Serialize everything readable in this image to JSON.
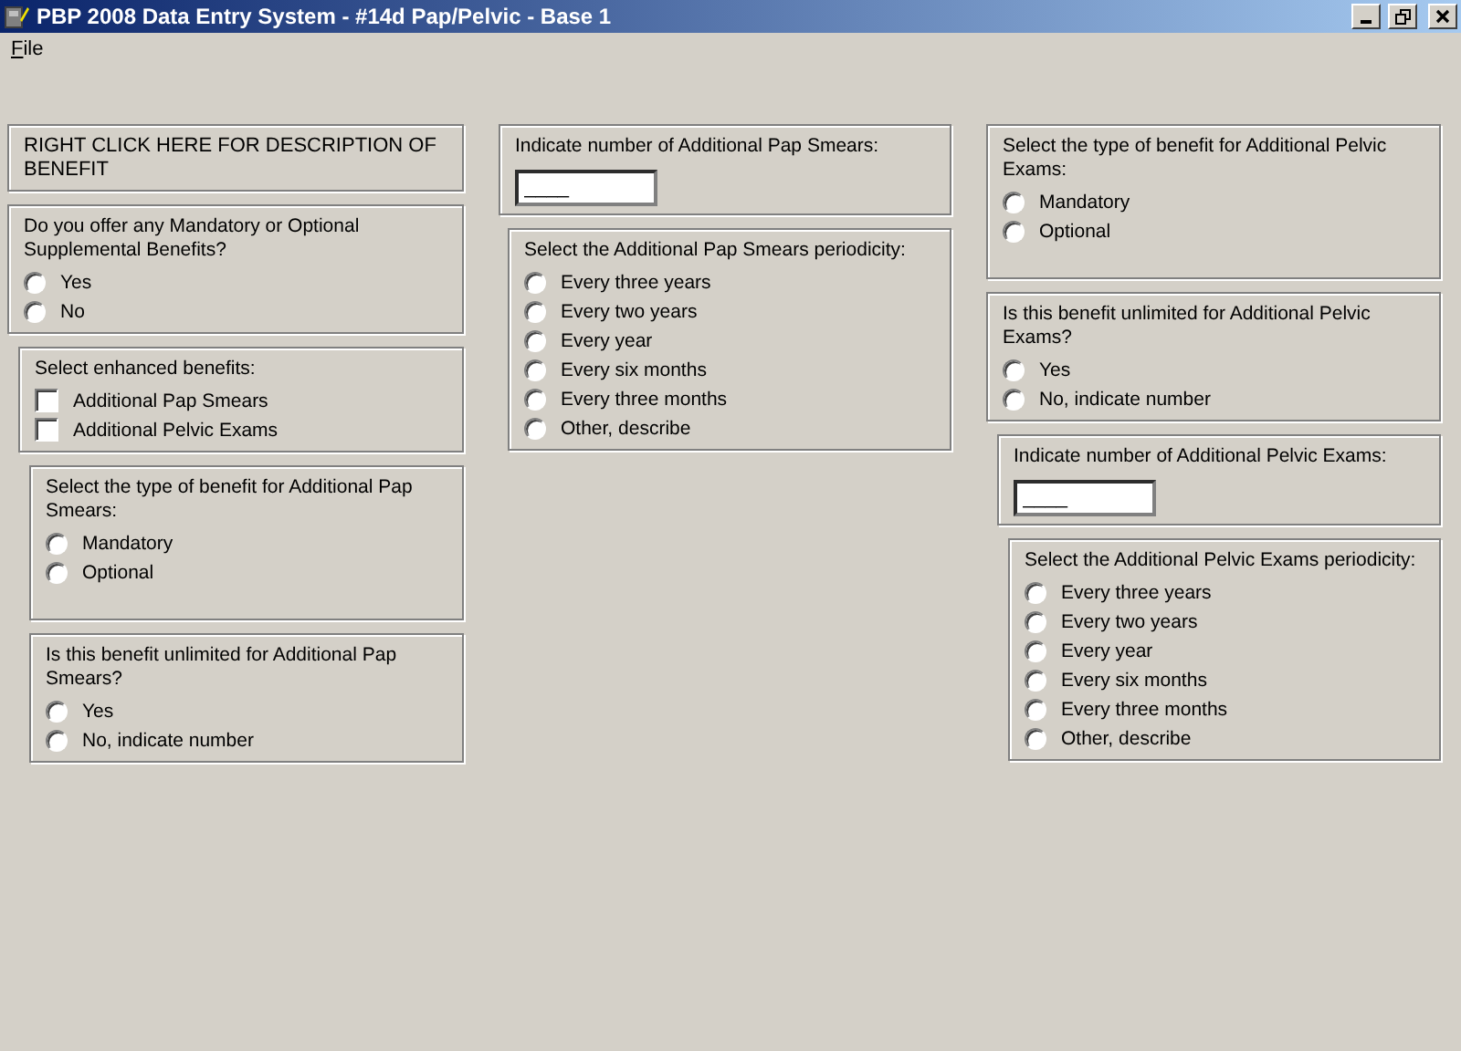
{
  "window": {
    "title": "PBP 2008 Data Entry System - #14d Pap/Pelvic - Base 1"
  },
  "menu": [
    {
      "label": "File"
    }
  ],
  "columns": [
    {
      "panels": [
        {
          "kind": "note",
          "text": "RIGHT CLICK HERE FOR DESCRIPTION OF BENEFIT"
        },
        {
          "kind": "radio",
          "question": "Do you offer any Mandatory or Optional Supplemental Benefits?",
          "options": [
            {
              "label": "Yes",
              "selected": false
            },
            {
              "label": "No",
              "selected": false
            }
          ]
        },
        {
          "kind": "checkbox",
          "question": "Select enhanced benefits:",
          "options": [
            {
              "label": "Additional Pap Smears",
              "checked": false
            },
            {
              "label": "Additional Pelvic Exams",
              "checked": false
            }
          ]
        },
        {
          "kind": "radio",
          "question": "Select the type of benefit for Additional Pap Smears:",
          "options": [
            {
              "label": "Mandatory",
              "selected": false
            },
            {
              "label": "Optional",
              "selected": false
            }
          ]
        },
        {
          "kind": "radio",
          "question": "Is this benefit unlimited for Additional Pap Smears?",
          "options": [
            {
              "label": "Yes",
              "selected": false
            },
            {
              "label": "No, indicate number",
              "selected": false
            }
          ]
        }
      ]
    },
    {
      "panels": [
        {
          "kind": "input",
          "question": "Indicate number of Additional Pap Smears:",
          "value": "____"
        },
        {
          "kind": "radio",
          "question": "Select the Additional Pap Smears periodicity:",
          "options": [
            {
              "label": "Every three years",
              "selected": false
            },
            {
              "label": "Every two years",
              "selected": false
            },
            {
              "label": "Every year",
              "selected": false
            },
            {
              "label": "Every six months",
              "selected": false
            },
            {
              "label": "Every three months",
              "selected": false
            },
            {
              "label": "Other, describe",
              "selected": false
            }
          ]
        }
      ]
    },
    {
      "panels": [
        {
          "kind": "radio",
          "question": "Select the type of benefit for Additional Pelvic Exams:",
          "options": [
            {
              "label": "Mandatory",
              "selected": false
            },
            {
              "label": "Optional",
              "selected": false
            }
          ]
        },
        {
          "kind": "radio",
          "question": "Is this benefit unlimited for Additional Pelvic Exams?",
          "options": [
            {
              "label": "Yes",
              "selected": false
            },
            {
              "label": "No, indicate number",
              "selected": false
            }
          ]
        },
        {
          "kind": "input",
          "question": "Indicate number of Additional Pelvic Exams:",
          "value": "____"
        },
        {
          "kind": "radio",
          "question": "Select the Additional Pelvic Exams periodicity:",
          "options": [
            {
              "label": "Every three years",
              "selected": false
            },
            {
              "label": "Every two years",
              "selected": false
            },
            {
              "label": "Every year",
              "selected": false
            },
            {
              "label": "Every six months",
              "selected": false
            },
            {
              "label": "Every three months",
              "selected": false
            },
            {
              "label": "Other, describe",
              "selected": false
            }
          ]
        }
      ]
    }
  ]
}
